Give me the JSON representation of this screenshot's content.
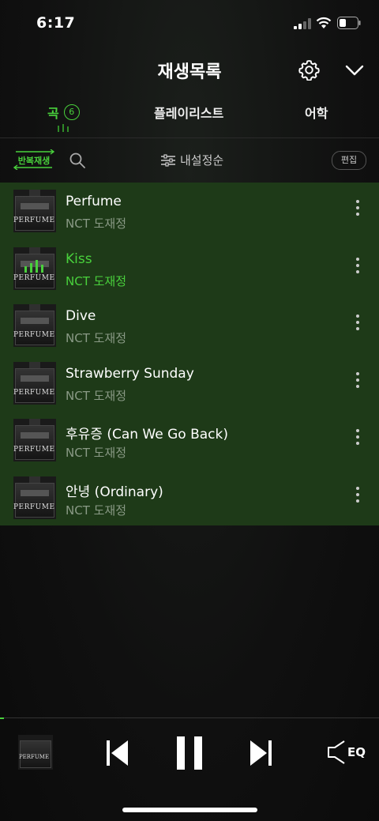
{
  "status_bar": {
    "time": "6:17"
  },
  "header": {
    "title": "재생목록"
  },
  "tabs": [
    {
      "label": "곡",
      "count": "6",
      "active": true
    },
    {
      "label": "플레이리스트",
      "active": false
    },
    {
      "label": "어학",
      "active": false
    }
  ],
  "toolbar": {
    "repeat_label": "반복재생",
    "sort_label": "내설정순",
    "edit_label": "편집"
  },
  "songs": [
    {
      "title": "Perfume",
      "artist": "NCT 도재정",
      "playing": false
    },
    {
      "title": "Kiss",
      "artist": "NCT 도재정",
      "playing": true
    },
    {
      "title": "Dive",
      "artist": "NCT 도재정",
      "playing": false
    },
    {
      "title": "Strawberry Sunday",
      "artist": "NCT 도재정",
      "playing": false
    },
    {
      "title": "후유증 (Can We Go Back)",
      "artist": "NCT 도재정",
      "playing": false
    },
    {
      "title": "안녕 (Ordinary)",
      "artist": "NCT 도재정",
      "playing": false
    }
  ],
  "album_art_text": "PERFUME",
  "player": {
    "eq_label": "EQ",
    "progress": 0.01
  },
  "colors": {
    "accent": "#49d13c",
    "list_bg": "#1e3a18",
    "background": "#0e0e0e"
  },
  "icons": [
    "signal-icon",
    "wifi-icon",
    "battery-icon",
    "gear-icon",
    "chevron-down-icon",
    "search-icon",
    "sliders-icon",
    "more-icon",
    "prev-icon",
    "pause-icon",
    "next-icon",
    "eq-icon"
  ]
}
